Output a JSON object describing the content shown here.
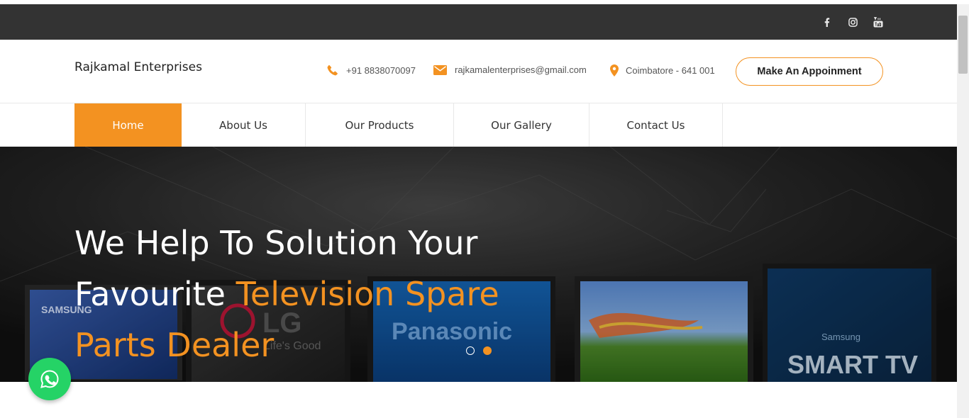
{
  "social": {
    "facebook_icon": "facebook-icon",
    "instagram_icon": "instagram-icon",
    "youtube_icon": "youtube-icon"
  },
  "header": {
    "brand": "Rajkamal Enterprises",
    "phone": "+91 8838070097",
    "email": "rajkamalenterprises@gmail.com",
    "location": "Coimbatore - 641 001",
    "appointment_button": "Make An Appoinment"
  },
  "nav": {
    "items": [
      {
        "label": "Home",
        "active": true
      },
      {
        "label": "About Us"
      },
      {
        "label": "Our Products"
      },
      {
        "label": "Our Gallery"
      },
      {
        "label": "Contact Us"
      }
    ]
  },
  "hero": {
    "line1": "We Help To Solution Your",
    "line2_white": "Favourite ",
    "line2_orange": "Television Spare",
    "line3_orange": "Parts Dealer",
    "tv_labels": [
      "SAMSUNG",
      "LG",
      "Life's Good",
      "Panasonic",
      "Samsung",
      "SMART TV"
    ],
    "slides": 2,
    "active_slide": 2
  },
  "colors": {
    "accent": "#f39221",
    "topbar": "#333333",
    "whatsapp": "#25d366"
  }
}
